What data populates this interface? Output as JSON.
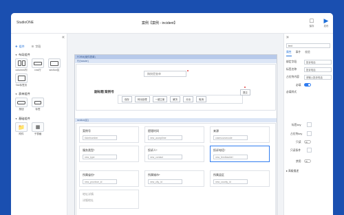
{
  "app": {
    "name": "StudioONE",
    "doc_title": "案例【案例 - incident】"
  },
  "toolbar": {
    "save_label": "保存",
    "publish_label": "发布"
  },
  "left_panel": {
    "tabs": [
      {
        "label": "组件",
        "icon": "puzzle-icon"
      },
      {
        "label": "字段",
        "icon": "list-icon"
      }
    ],
    "sections": [
      {
        "title": "布局组件",
        "items": [
          {
            "label": "columns列"
          },
          {
            "label": "row行"
          },
          {
            "label": "section区"
          },
          {
            "label": "Tab标签页"
          }
        ]
      },
      {
        "title": "表单组件",
        "items": [
          {
            "label": "按钮"
          },
          {
            "label": "标签"
          }
        ]
      },
      {
        "title": "基础组件",
        "items": [
          {
            "label": "附件"
          },
          {
            "label": "子表格"
          }
        ]
      }
    ]
  },
  "canvas": {
    "form_bar": "FORM(案件表单)",
    "header_bar": "行(header)",
    "search_placeholder": "稿按提查单",
    "title": "副标题 案例号",
    "buttons": [
      "保存",
      "转派处理",
      "一键立案",
      "解决",
      "分派",
      "取消"
    ],
    "side_button": "提交",
    "section_bar": "section(区)",
    "fields": [
      {
        "label": "案例号",
        "value": "ticketnumber"
      },
      {
        "label": "提理时间",
        "value": "new_acceptime"
      },
      {
        "label": "来源",
        "value": "casesourcecode"
      },
      {
        "label": "服务类型*",
        "value": "new_type"
      },
      {
        "label": "投诉人*",
        "value": "new_contact"
      },
      {
        "label": "投诉电话*",
        "value": "new_feedbacktel"
      },
      {
        "label": "所属省份*",
        "value": "new_province_id"
      },
      {
        "label": "所属城市*",
        "value": "new_city_id"
      },
      {
        "label": "所属县区",
        "value": "new_county_id"
      },
      {
        "label": "地址详情",
        "value": "详细地址"
      }
    ]
  },
  "right_panel": {
    "search_value": "text",
    "tabs": [
      "属性",
      "事件",
      "校验"
    ],
    "props": [
      {
        "label": "绑定字段",
        "value": "投诉电话"
      },
      {
        "label": "标签名称",
        "value": "投诉电话"
      },
      {
        "label": "占位符内容",
        "value": "请输入投诉电话"
      }
    ],
    "toggles": [
      {
        "label": "必填",
        "on": true
      },
      {
        "label": "只读",
        "on": false
      },
      {
        "label": "禁用",
        "on": false
      }
    ],
    "more": [
      "必填样式",
      "标签key",
      "占位符key",
      "只读条件"
    ],
    "advanced": "高级描述"
  }
}
